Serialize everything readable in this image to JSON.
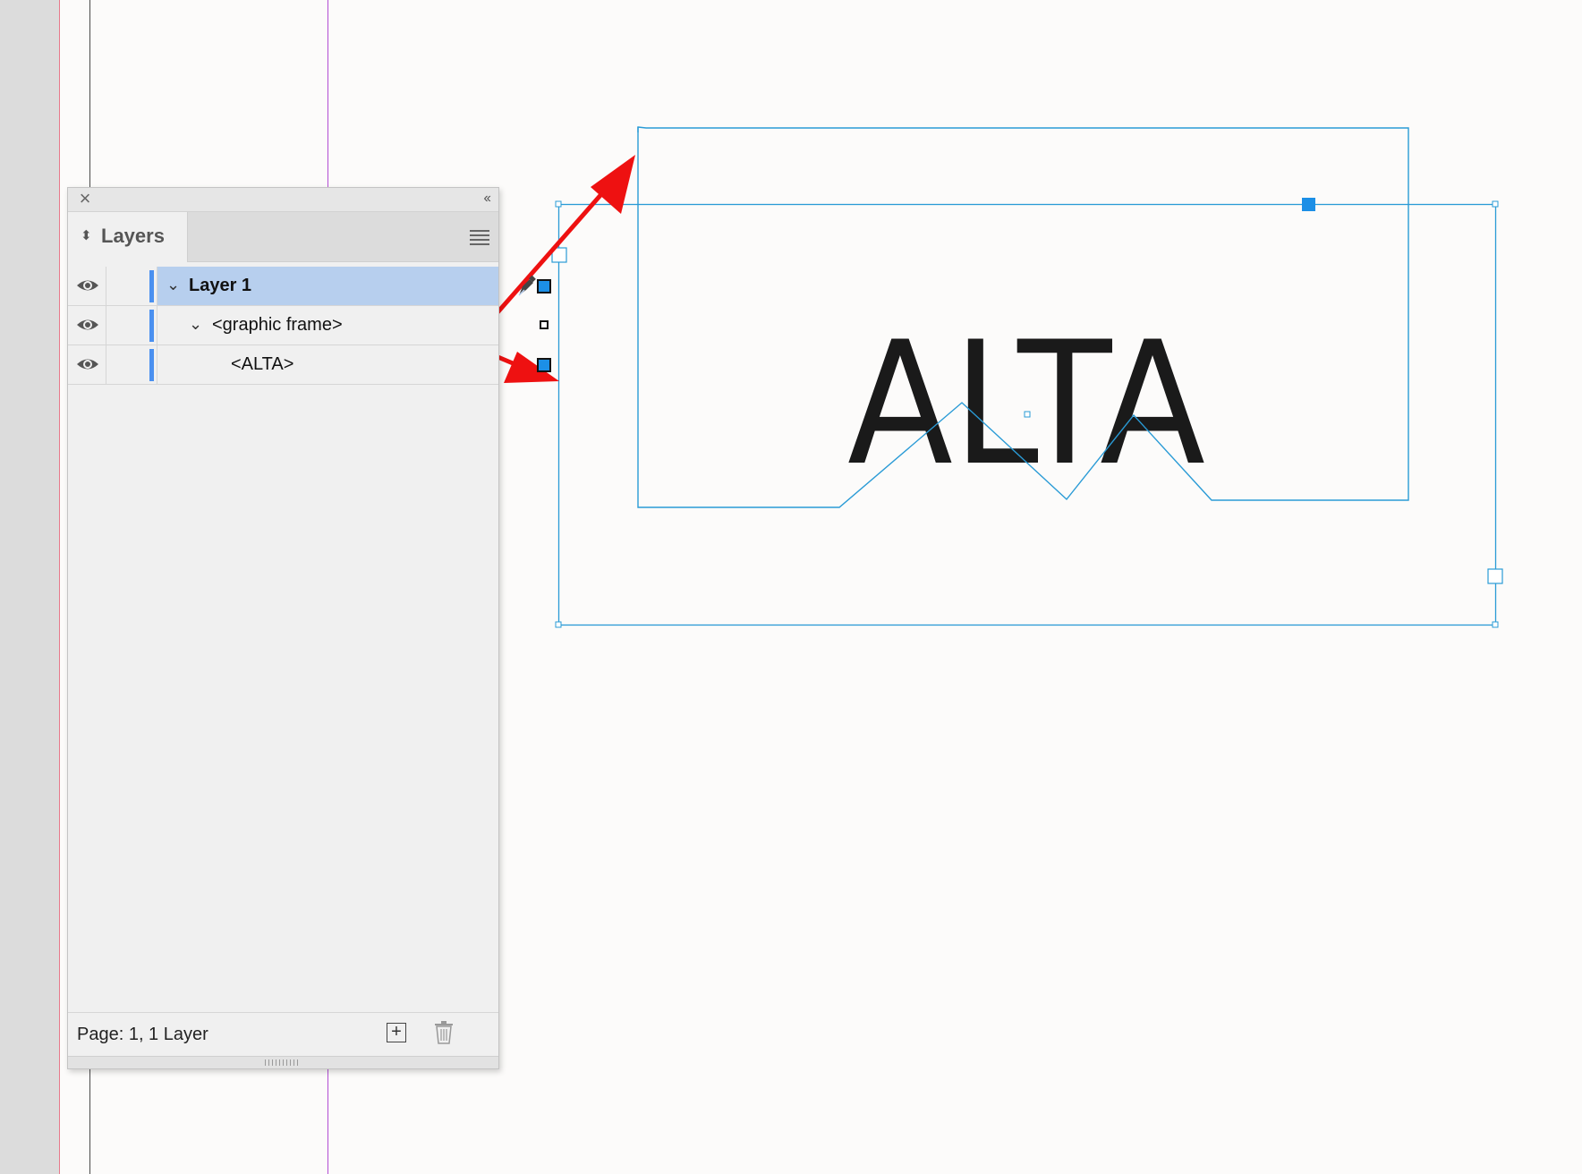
{
  "panel": {
    "tab_title": "Layers",
    "close_glyph": "×",
    "collapse_glyph": "‹‹",
    "sort_glyph": "⬍",
    "menu_icon": "hamburger-menu-icon"
  },
  "layers": [
    {
      "label": "Layer 1",
      "visible": true,
      "expanded": true,
      "indent": 0,
      "selected": true,
      "target_icon": "pen-icon"
    },
    {
      "label": "<graphic frame>",
      "visible": true,
      "expanded": true,
      "indent": 1,
      "selected": false
    },
    {
      "label": "<ALTA>",
      "visible": true,
      "expanded": false,
      "indent": 2,
      "selected": false
    }
  ],
  "footer": {
    "status": "Page: 1, 1 Layer",
    "new_layer_glyph": "+"
  },
  "artwork": {
    "text": "ALTA"
  },
  "colors": {
    "selection_blue": "#1c8fe6",
    "frame_line": "#2a9bd6",
    "annotation_arrow": "#ee1111",
    "layer_color": "#4a90f0",
    "row_highlight": "#b7cfee"
  }
}
